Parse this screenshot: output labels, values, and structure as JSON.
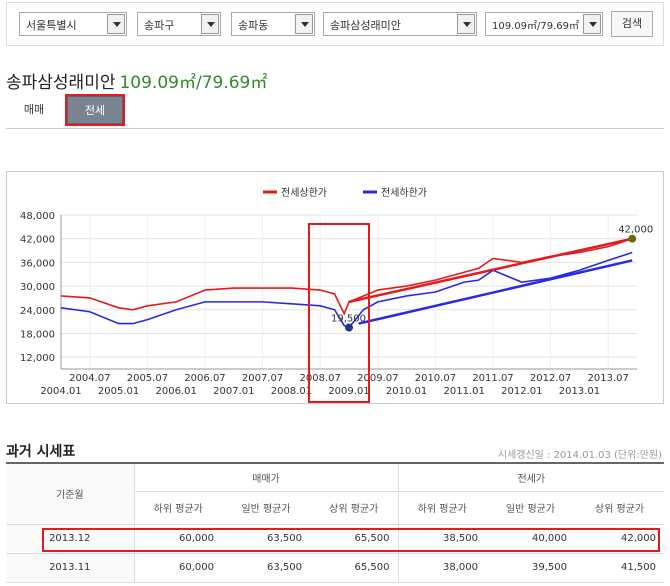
{
  "filters": {
    "city": "서울특별시",
    "district": "송파구",
    "dong": "송파동",
    "apartment": "송파삼성래미안",
    "size": "109.09㎡/79.69㎡",
    "search_label": "검색"
  },
  "title": {
    "name": "송파삼성래미안",
    "area": "109.09㎡/79.69㎡"
  },
  "tabs": [
    {
      "label": "매매",
      "active": false
    },
    {
      "label": "전세",
      "active": true
    }
  ],
  "colors": {
    "upper": "#e41b1b",
    "lower": "#2a2ae6",
    "highlight": "#e41b1b",
    "accent_green": "#2e8b2e"
  },
  "chart_data": {
    "type": "line",
    "legend": [
      "전세상한가",
      "전세하한가"
    ],
    "legend_position": "top-center",
    "y_ticks": [
      "48,000",
      "42,000",
      "36,000",
      "30,000",
      "24,000",
      "18,000",
      "12,000"
    ],
    "ylim": [
      9000,
      48000
    ],
    "x_ticks_top": [
      "2004.07",
      "2005.07",
      "2006.07",
      "2007.07",
      "2008.07",
      "2009.07",
      "2010.07",
      "2011.07",
      "2012.07",
      "2013.07"
    ],
    "x_ticks_bottom": [
      "2004.01",
      "2005.01",
      "2006.01",
      "2007.01",
      "2008.01",
      "2009.01",
      "2010.01",
      "2011.01",
      "2012.01",
      "2013.01"
    ],
    "grid": true,
    "annotations": [
      {
        "label": "19,500",
        "x": "2009.01",
        "y": 19500
      },
      {
        "label": "42,000",
        "x": "2013.12",
        "y": 42000
      }
    ],
    "series": [
      {
        "name": "전세상한가",
        "x": [
          "2004.01",
          "2004.07",
          "2005.01",
          "2005.04",
          "2005.07",
          "2006.01",
          "2006.07",
          "2007.01",
          "2007.07",
          "2008.01",
          "2008.07",
          "2008.10",
          "2008.12",
          "2009.01",
          "2009.04",
          "2009.07",
          "2010.01",
          "2010.07",
          "2011.01",
          "2011.04",
          "2011.07",
          "2012.01",
          "2012.07",
          "2013.01",
          "2013.07",
          "2013.12"
        ],
        "values": [
          27500,
          27000,
          24500,
          24000,
          25000,
          26000,
          29000,
          29500,
          29500,
          29500,
          29000,
          28000,
          23000,
          26000,
          27500,
          29000,
          30000,
          31500,
          33500,
          34500,
          37000,
          36000,
          37500,
          38500,
          40000,
          42000
        ]
      },
      {
        "name": "전세하한가",
        "x": [
          "2004.01",
          "2004.07",
          "2005.01",
          "2005.04",
          "2005.07",
          "2006.01",
          "2006.07",
          "2007.01",
          "2007.07",
          "2008.01",
          "2008.07",
          "2008.10",
          "2008.12",
          "2009.01",
          "2009.04",
          "2009.07",
          "2010.01",
          "2010.07",
          "2011.01",
          "2011.04",
          "2011.07",
          "2012.01",
          "2012.07",
          "2013.01",
          "2013.07",
          "2013.12"
        ],
        "values": [
          24500,
          23500,
          20500,
          20500,
          21500,
          24000,
          26000,
          26000,
          26000,
          25500,
          25000,
          24000,
          20000,
          19500,
          24000,
          26000,
          27500,
          28500,
          31000,
          31500,
          34000,
          31000,
          32000,
          34000,
          36500,
          38500
        ]
      },
      {
        "name": "",
        "values_note": "",
        "x": [
          "2009.01",
          "2013.12"
        ],
        "values": [
          26000,
          42000
        ],
        "trend_of": "전세상한가"
      },
      {
        "name": "",
        "x": [
          "2009.03",
          "2013.12"
        ],
        "values": [
          20500,
          36500
        ],
        "trend_of": "전세하한가"
      }
    ]
  },
  "history": {
    "title": "과거 시세표",
    "note": "시세갱신일 : 2014.01.03 (단위:만원)",
    "col_base": "기준월",
    "group_sale": "매매가",
    "group_jeonse": "전세가",
    "sub_headers": [
      "하위 평균가",
      "일반 평균가",
      "상위 평균가",
      "하위 평균가",
      "일반 평균가",
      "상위 평균가"
    ],
    "rows": [
      {
        "month": "2013.12",
        "values": [
          "60,000",
          "63,500",
          "65,500",
          "38,500",
          "40,000",
          "42,000"
        ]
      },
      {
        "month": "2013.11",
        "values": [
          "60,000",
          "63,500",
          "65,500",
          "38,000",
          "39,500",
          "41,500"
        ]
      }
    ]
  }
}
